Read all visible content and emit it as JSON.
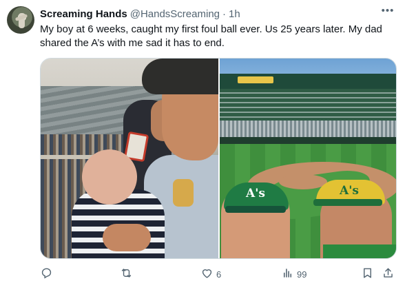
{
  "post": {
    "author_name": "Screaming Hands",
    "handle": "@HandsScreaming",
    "separator": "·",
    "time": "1h",
    "more_label": "•••",
    "text": "My boy at 6 weeks, caught my first foul ball ever. Us 25 years later.  My dad shared the A’s with me sad it has to end.",
    "media": [
      {
        "icon": "photo-vintage-ballpark"
      },
      {
        "icon": "photo-stadium-selfie",
        "cap_left_logo": "A's",
        "cap_right_logo": "A's"
      }
    ]
  },
  "actions": {
    "reply": {
      "icon": "reply-icon",
      "count": ""
    },
    "repost": {
      "icon": "repost-icon",
      "count": ""
    },
    "like": {
      "icon": "heart-icon",
      "count": "6"
    },
    "views": {
      "icon": "views-icon",
      "count": "99"
    },
    "bookmark": {
      "icon": "bookmark-icon"
    },
    "share": {
      "icon": "share-icon"
    }
  },
  "colors": {
    "text": "#0f1419",
    "muted": "#536471",
    "border": "#cfd9de"
  }
}
